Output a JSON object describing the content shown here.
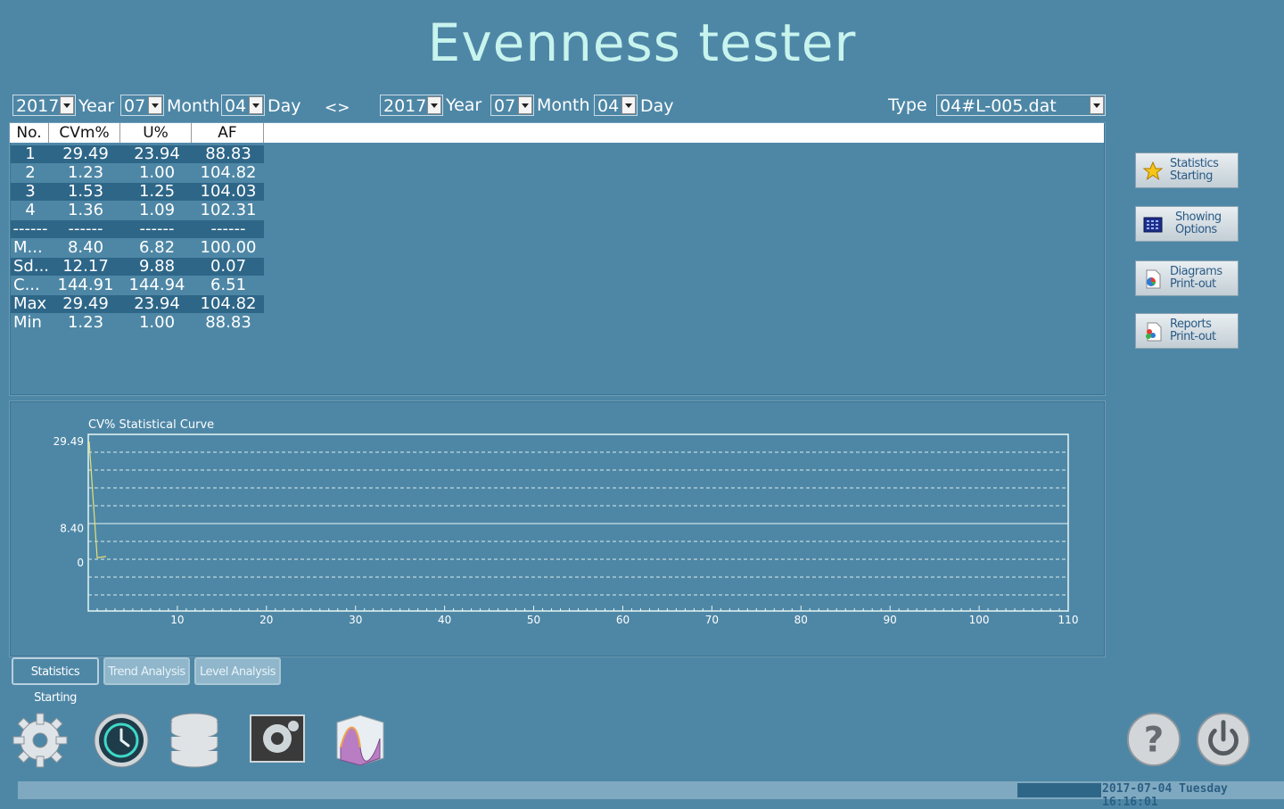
{
  "app": {
    "title": "Evenness tester"
  },
  "filter": {
    "from": {
      "year": "2017",
      "year_label": "Year",
      "month": "07",
      "month_label": "Month",
      "day": "04",
      "day_label": "Day"
    },
    "separator": "<>",
    "to": {
      "year": "2017",
      "year_label": "Year",
      "month": "07",
      "month_label": "Month",
      "day": "04",
      "day_label": "Day"
    },
    "type_label": "Type",
    "type_value": "04#L-005.dat"
  },
  "table": {
    "headers": [
      "No.",
      "CVm%",
      "U%",
      "AF"
    ],
    "rows": [
      [
        "1",
        "29.49",
        "23.94",
        "88.83"
      ],
      [
        "2",
        "1.23",
        "1.00",
        "104.82"
      ],
      [
        "3",
        "1.53",
        "1.25",
        "104.03"
      ],
      [
        "4",
        "1.36",
        "1.09",
        "102.31"
      ],
      [
        "------",
        "------",
        "------",
        "------"
      ],
      [
        "M...",
        "8.40",
        "6.82",
        "100.00"
      ],
      [
        "Sd...",
        "12.17",
        "9.88",
        "0.07"
      ],
      [
        "C...",
        "144.91",
        "144.94",
        "6.51"
      ],
      [
        "Max",
        "29.49",
        "23.94",
        "104.82"
      ],
      [
        "Min",
        "1.23",
        "1.00",
        "88.83"
      ]
    ]
  },
  "side_buttons": [
    {
      "line1": "Statistics",
      "line2": "Starting",
      "icon": "star-icon"
    },
    {
      "line1": "Showing",
      "line2": "Options",
      "icon": "grid-icon"
    },
    {
      "line1": "Diagrams",
      "line2": "Print-out",
      "icon": "pie-document-icon"
    },
    {
      "line1": "Reports",
      "line2": "Print-out",
      "icon": "report-document-icon"
    }
  ],
  "tabs": [
    "Statistics Starting",
    "Trend Analysis",
    "Level Analysis"
  ],
  "dock_icons": [
    "gear-icon",
    "clock-icon",
    "database-icon",
    "settings-screen-icon",
    "surface-chart-icon"
  ],
  "status": {
    "datetime": "2017-07-04 Tuesday 16:16:01"
  },
  "colors": {
    "background": "#4e87a6",
    "title": "#c8f4ee",
    "curve": "#e8e070",
    "highlight_row": "#2e6688"
  },
  "chart_data": {
    "type": "line",
    "title": "CV% Statistical Curve",
    "x": [
      1,
      2,
      3
    ],
    "series": [
      {
        "values": [
          29.49,
          1.23,
          1.53
        ]
      }
    ],
    "y_ticks": [
      "29.49",
      "8.40",
      "0"
    ],
    "x_ticks": [
      "10",
      "20",
      "30",
      "40",
      "50",
      "60",
      "70",
      "80",
      "90",
      "100",
      "110"
    ],
    "xlim": [
      0,
      110
    ],
    "grid": true
  }
}
